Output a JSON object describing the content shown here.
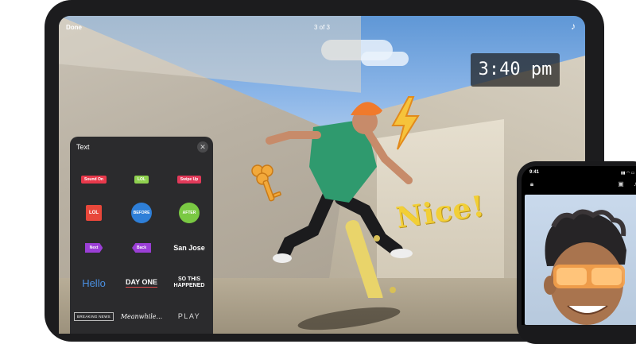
{
  "ipad": {
    "topbar": {
      "done_label": "Done",
      "page_indicator": "3 of 3",
      "music_icon": "music-note-icon"
    },
    "stickers": {
      "time": "3:40 pm",
      "nice": "Nice!",
      "bolt_icon": "lightning-bolt-icon",
      "key_icon": "key-icon"
    },
    "text_panel": {
      "title": "Text",
      "close_icon": "close-icon",
      "items": [
        {
          "label": "Sound On",
          "kind": "tag",
          "bg": "#e8394b"
        },
        {
          "label": "LOL",
          "kind": "tag",
          "bg": "#8fd14f"
        },
        {
          "label": "Swipe Up",
          "kind": "tag",
          "bg": "#e23a5a"
        },
        {
          "label": "LOL",
          "kind": "square",
          "bg": "#e8473a"
        },
        {
          "label": "BEFORE",
          "kind": "circle",
          "bg": "#2e7fd8"
        },
        {
          "label": "AFTER",
          "kind": "circle",
          "bg": "#7ac943"
        },
        {
          "label": "Next",
          "kind": "arrow-right",
          "bg": "#9b3fd6"
        },
        {
          "label": "Back",
          "kind": "arrow-left",
          "bg": "#9b3fd6"
        },
        {
          "label": "San Jose",
          "kind": "text-san"
        },
        {
          "label": "Hello",
          "kind": "text-hello"
        },
        {
          "label": "DAY ONE",
          "kind": "text-day"
        },
        {
          "label": "SO THIS HAPPENED",
          "kind": "text-sothis"
        },
        {
          "label": "BREAKING NEWS",
          "kind": "text-breaking"
        },
        {
          "label": "Meanwhile...",
          "kind": "text-mean"
        },
        {
          "label": "PLAY",
          "kind": "text-play"
        }
      ]
    }
  },
  "iphone": {
    "status_time": "9:41",
    "status_icons": "signal-wifi-battery-icons",
    "toolbar_icons": [
      "lock-icon",
      "layout-icon",
      "music-note-icon"
    ]
  },
  "colors": {
    "panel_bg": "#2b2b2d",
    "nice_yellow": "#f2cf36",
    "helmet_orange": "#f07a2c",
    "shirt_green": "#2f9a6e"
  }
}
